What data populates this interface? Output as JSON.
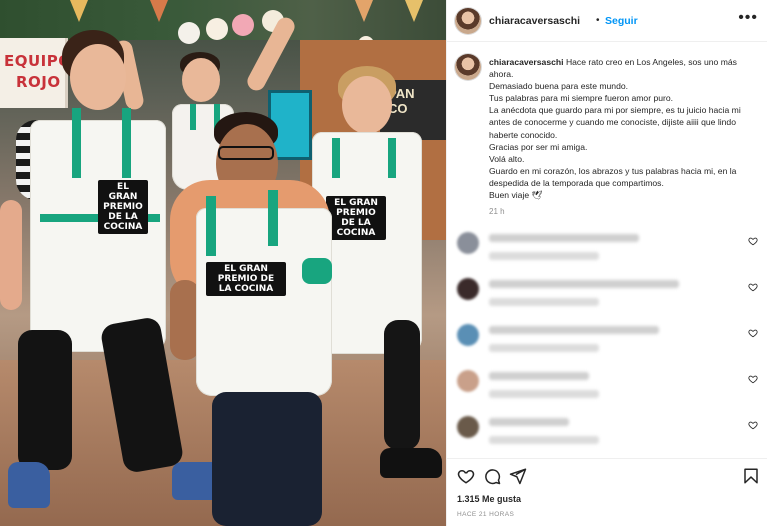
{
  "photo": {
    "sign_line1": "EQUIPO",
    "sign_line2": "ROJO",
    "counter_text": "PAN\nCO",
    "badges": [
      "EL GRAN PREMIO DE LA COCINA",
      "EL GRAN PREMIO DE LA COCINA",
      "EL GRAN PREMIO DE LA COCINA"
    ]
  },
  "header": {
    "username": "chiaracaversaschi",
    "separator": "•",
    "follow_label": "Seguir",
    "more_label": "•••"
  },
  "caption": {
    "username": "chiaracaversaschi",
    "lines": [
      "Hace rato creo en Los Angeles, sos uno más",
      "ahora.",
      "Demasiado buena para este mundo.",
      "Tus palabras para mi siempre fueron amor puro.",
      "La anécdota que guardo para mi por siempre, es tu juicio hacia mi",
      "antes de conocerme y cuando me conociste, dijiste aiiii que lindo",
      "haberte conocido.",
      "Gracias por ser mi amiga.",
      "Volá alto.",
      "Guardo en mi corazón, los abrazos y tus palabras hacia mi, en la",
      "despedida de la temporada que compartimos.",
      "Buen viaje 🕊"
    ],
    "time": "21 h"
  },
  "colors": {
    "accent": "#0095f6",
    "text": "#262626",
    "muted": "#8e8e8e",
    "apron_strap": "#18a57f"
  },
  "actions": {
    "icons": [
      "heart-icon",
      "comment-icon",
      "share-icon",
      "bookmark-icon"
    ],
    "likes": "1.315 Me gusta",
    "date": "HACE 21 HORAS"
  }
}
